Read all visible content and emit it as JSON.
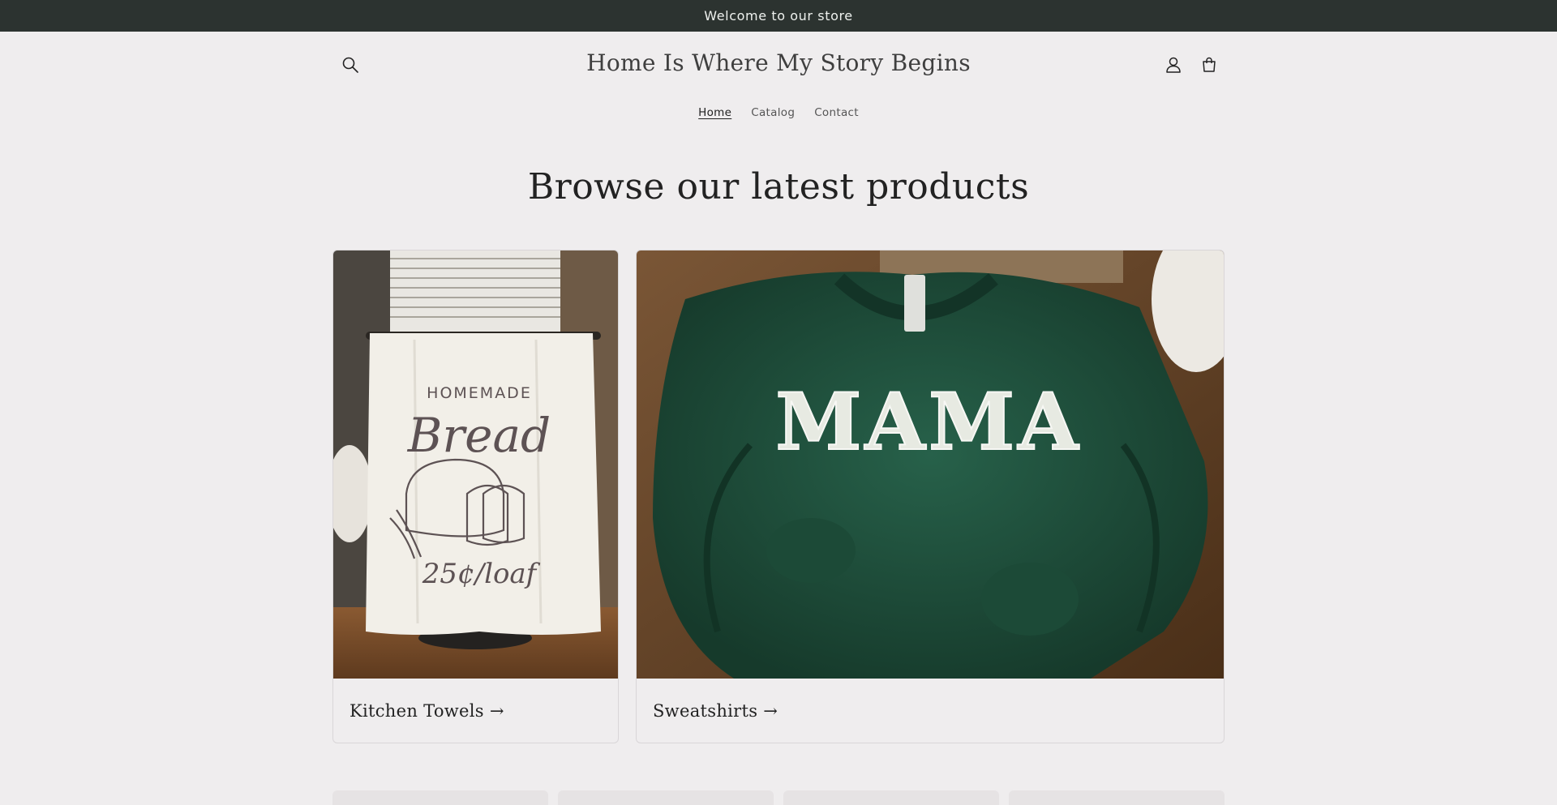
{
  "announcement": {
    "text": "Welcome to our store"
  },
  "header": {
    "title": "Home Is Where My Story Begins",
    "icons": [
      "search-icon",
      "account-icon",
      "cart-icon"
    ]
  },
  "nav": {
    "items": [
      {
        "label": "Home",
        "active": true
      },
      {
        "label": "Catalog",
        "active": false
      },
      {
        "label": "Contact",
        "active": false
      }
    ]
  },
  "main": {
    "heading": "Browse our latest products",
    "collections": [
      {
        "label": "Kitchen Towels →",
        "image_text": {
          "line1": "HOMEMADE",
          "line2": "Bread",
          "line3": "25¢/loaf"
        }
      },
      {
        "label": "Sweatshirts →",
        "image_text": {
          "line1": "MAMA"
        }
      }
    ]
  },
  "colors": {
    "announcement_bg": "#2c3330",
    "page_bg": "#efedee",
    "sweatshirt_green": "#1f4a36"
  }
}
